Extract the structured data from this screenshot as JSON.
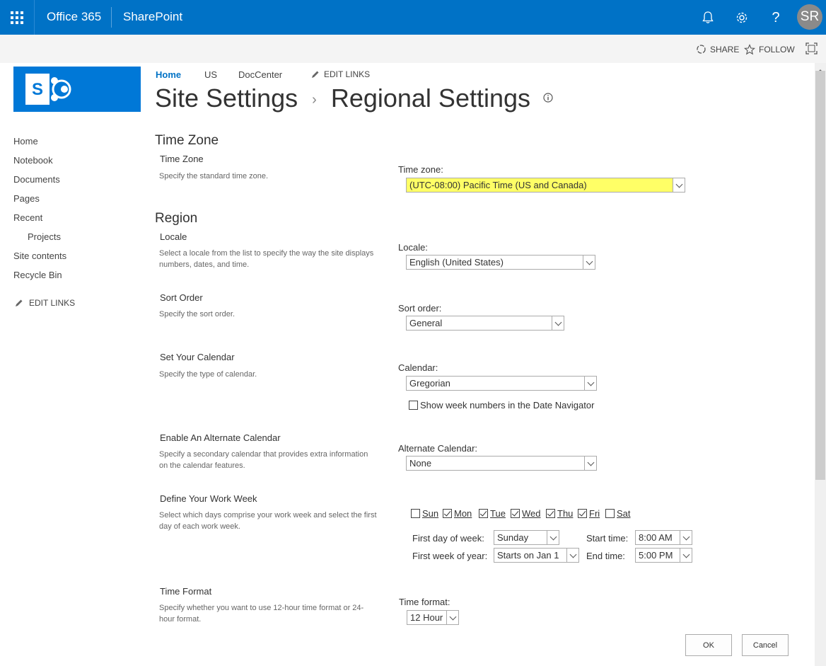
{
  "suitebar": {
    "app_name": "Office 365",
    "site_brand": "SharePoint",
    "avatar_initials": "SR",
    "icons": [
      "app-launcher-icon",
      "bell-icon",
      "gear-icon",
      "help-icon"
    ]
  },
  "ribbon": {
    "share_label": "SHARE",
    "follow_label": "FOLLOW"
  },
  "topnav": {
    "items": [
      "Home",
      "US",
      "DocCenter"
    ],
    "edit_links": "EDIT LINKS"
  },
  "title": {
    "parent": "Site Settings",
    "current": "Regional Settings",
    "separator": "›"
  },
  "quicklaunch": {
    "items": [
      "Home",
      "Notebook",
      "Documents",
      "Pages",
      "Recent",
      "Projects",
      "Site contents",
      "Recycle Bin"
    ],
    "edit_links": "EDIT LINKS"
  },
  "timezone_section": {
    "heading": "Time Zone",
    "title": "Time Zone",
    "desc": "Specify the standard time zone.",
    "label": "Time zone:",
    "value": "(UTC-08:00) Pacific Time (US and Canada)",
    "highlight_color": "#ffff66"
  },
  "region_section": {
    "heading": "Region",
    "locale": {
      "title": "Locale",
      "desc": "Select a locale from the list to specify the way the site displays numbers, dates, and time.",
      "label": "Locale:",
      "value": "English (United States)"
    },
    "sort": {
      "title": "Sort Order",
      "desc": "Specify the sort order.",
      "label": "Sort order:",
      "value": "General"
    },
    "calendar": {
      "title": "Set Your Calendar",
      "desc": "Specify the type of calendar.",
      "label": "Calendar:",
      "value": "Gregorian",
      "week_numbers_label": "Show week numbers in the Date Navigator",
      "week_numbers_checked": false
    },
    "alt_calendar": {
      "title": "Enable An Alternate Calendar",
      "desc": "Specify a secondary calendar that provides extra information on the calendar features.",
      "label": "Alternate Calendar:",
      "value": "None"
    },
    "work_week": {
      "title": "Define Your Work Week",
      "desc": "Select which days comprise your work week and select the first day of each work week.",
      "days": [
        {
          "label": "Sun",
          "checked": false
        },
        {
          "label": "Mon",
          "checked": true
        },
        {
          "label": "Tue",
          "checked": true
        },
        {
          "label": "Wed",
          "checked": true
        },
        {
          "label": "Thu",
          "checked": true
        },
        {
          "label": "Fri",
          "checked": true
        },
        {
          "label": "Sat",
          "checked": false
        }
      ],
      "first_day_label": "First day of week:",
      "first_day_value": "Sunday",
      "first_week_label": "First week of year:",
      "first_week_value": "Starts on Jan 1",
      "start_time_label": "Start time:",
      "start_time_value": "8:00 AM",
      "end_time_label": "End time:",
      "end_time_value": "5:00 PM"
    },
    "time_format": {
      "title": "Time Format",
      "desc": "Specify whether you want to use 12-hour time format or 24-hour format.",
      "label": "Time format:",
      "value": "12 Hour"
    }
  },
  "buttons": {
    "ok": "OK",
    "cancel": "Cancel"
  },
  "colors": {
    "suitebar": "#0072c6",
    "logo": "#0078d7",
    "accent_link": "#0072c6"
  }
}
